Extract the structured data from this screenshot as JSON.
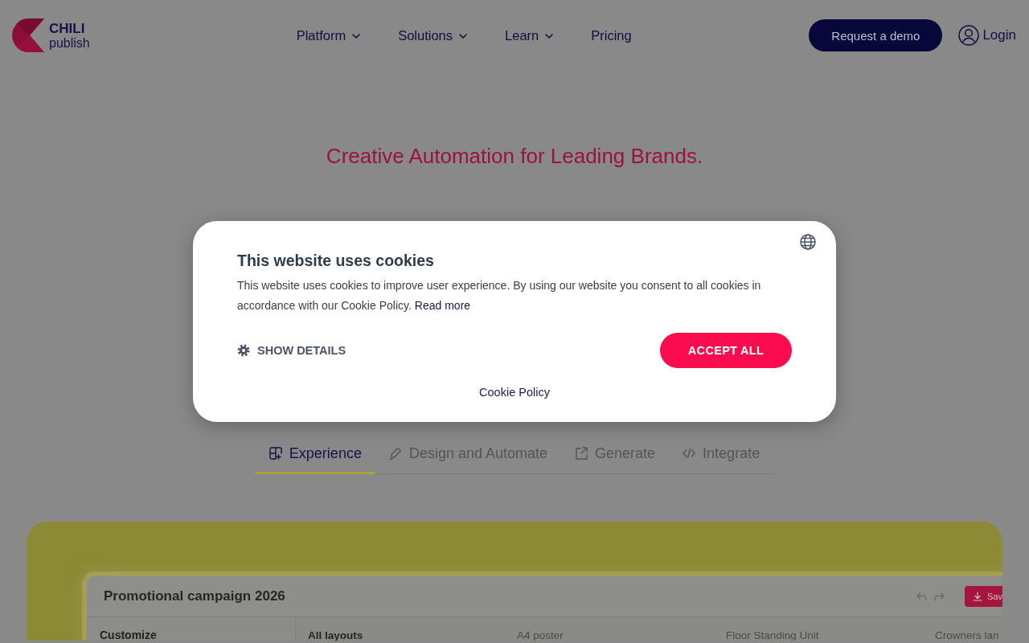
{
  "header": {
    "logo": {
      "line_1": "CHILI",
      "line_2": "publish"
    },
    "nav": [
      {
        "label": "Platform",
        "has_menu": true
      },
      {
        "label": "Solutions",
        "has_menu": true
      },
      {
        "label": "Learn",
        "has_menu": true
      },
      {
        "label": "Pricing",
        "has_menu": false
      }
    ],
    "demo_button": "Request a demo",
    "login": "Login"
  },
  "hero": {
    "tagline": "Creative Automation for Leading Brands."
  },
  "cookie_dialog": {
    "title": "This website uses cookies",
    "message": "This website uses cookies to improve user experience. By using our website you consent to all cookies in accordance with our Cookie Policy.",
    "read_more": "Read more",
    "show_details": "SHOW DETAILS",
    "accept_button": "ACCEPT ALL",
    "policy_link": "Cookie Policy"
  },
  "tabs": [
    {
      "label": "Experience",
      "selected": true
    },
    {
      "label": "Design and Automate",
      "selected": false
    },
    {
      "label": "Generate",
      "selected": false
    },
    {
      "label": "Integrate",
      "selected": false
    }
  ],
  "preview": {
    "title": "Promotional campaign 2026",
    "save_button": "Sav",
    "sidebar_heading": "Customize",
    "layouts_heading": "All layouts",
    "layouts": [
      "A4 poster",
      "Floor Standing Unit",
      "Crowners lan"
    ]
  }
}
